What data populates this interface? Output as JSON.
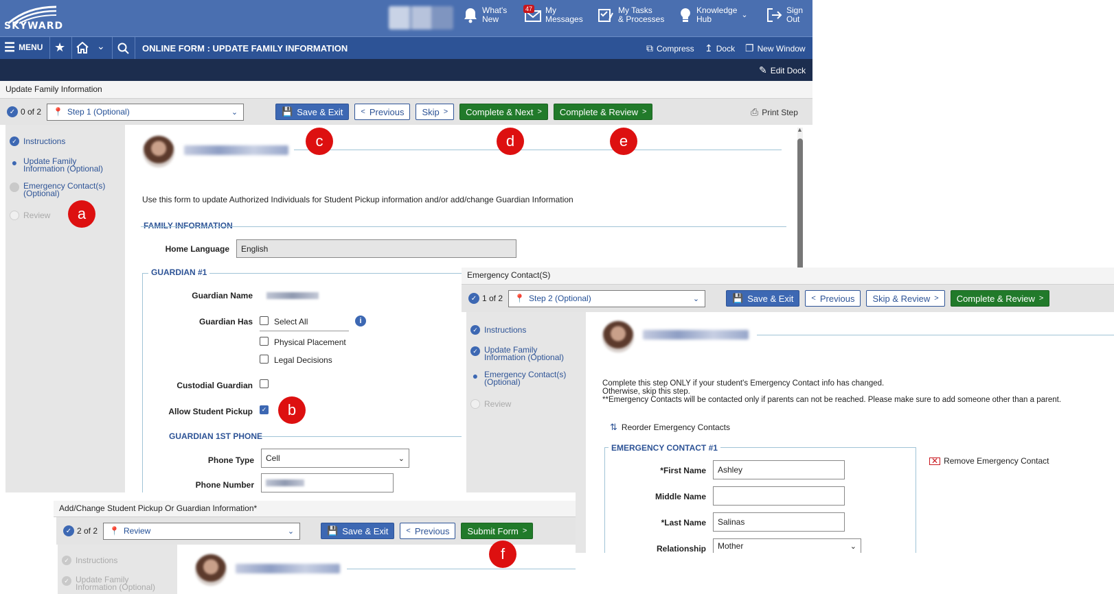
{
  "header": {
    "logo": "SKYWARD",
    "nav": [
      {
        "icon": "bell-icon",
        "label": "What's\nNew"
      },
      {
        "icon": "envelope-icon",
        "label": "My\nMessages",
        "badge": "47"
      },
      {
        "icon": "tasks-icon",
        "label": "My Tasks\n& Processes"
      },
      {
        "icon": "lightbulb-icon",
        "label": "Knowledge\nHub"
      },
      {
        "icon": "sign-out-icon",
        "label": "Sign\nOut"
      }
    ]
  },
  "navbar": {
    "menu": "MENU",
    "title": "ONLINE FORM : UPDATE FAMILY INFORMATION",
    "compress": "Compress",
    "dock": "Dock",
    "new_window": "New Window",
    "edit_dock": "Edit Dock"
  },
  "panel1": {
    "title": "Update Family Information",
    "progress": "0 of 2",
    "step": "Step 1 (Optional)",
    "buttons": {
      "save_exit": "Save & Exit",
      "previous": "Previous",
      "skip": "Skip",
      "complete_next": "Complete & Next",
      "complete_review": "Complete & Review",
      "print_step": "Print Step"
    },
    "sidebar": [
      "Instructions",
      "Update Family\nInformation (Optional)",
      "Emergency Contact(s)\n(Optional)",
      "Review"
    ],
    "intro": "Use this form to update Authorized Individuals for Student Pickup information and/or add/change Guardian Information",
    "family_heading": "FAMILY INFORMATION",
    "home_language_label": "Home Language",
    "home_language": "English",
    "guardian_heading": "GUARDIAN #1",
    "guardian_name_label": "Guardian Name",
    "guardian_has_label": "Guardian Has",
    "select_all": "Select All",
    "physical_placement": "Physical Placement",
    "legal_decisions": "Legal Decisions",
    "custodial_label": "Custodial Guardian",
    "pickup_label": "Allow Student Pickup",
    "phone_heading": "GUARDIAN 1ST PHONE",
    "phone_type_label": "Phone Type",
    "phone_type": "Cell",
    "phone_number_label": "Phone Number"
  },
  "panel2": {
    "title": "Emergency Contact(S)",
    "progress": "1 of 2",
    "step": "Step 2 (Optional)",
    "buttons": {
      "save_exit": "Save & Exit",
      "previous": "Previous",
      "skip_review": "Skip & Review",
      "complete_review": "Complete & Review"
    },
    "sidebar": [
      "Instructions",
      "Update Family\nInformation (Optional)",
      "Emergency Contact(s)\n(Optional)",
      "Review"
    ],
    "intro": "Complete this step ONLY if your student's Emergency Contact info has changed.\nOtherwise, skip this step.\n**Emergency Contacts will be contacted only if parents can not be reached. Please make sure to add someone other than a parent.",
    "reorder": "Reorder Emergency Contacts",
    "contact_heading": "EMERGENCY CONTACT #1",
    "remove": "Remove Emergency Contact",
    "first_name_label": "*First Name",
    "first_name": "Ashley",
    "middle_name_label": "Middle Name",
    "last_name_label": "*Last Name",
    "last_name": "Salinas",
    "relationship_label": "Relationship",
    "relationship": "Mother"
  },
  "panel3": {
    "title": "Add/Change Student Pickup Or Guardian Information*",
    "progress": "2 of 2",
    "step": "Review",
    "buttons": {
      "save_exit": "Save & Exit",
      "previous": "Previous",
      "submit": "Submit Form"
    },
    "sidebar": [
      "Instructions",
      "Update Family\nInformation (Optional)"
    ]
  },
  "markers": {
    "a": "a",
    "b": "b",
    "c": "c",
    "d": "d",
    "e": "e",
    "f": "f"
  },
  "colors": {
    "header": "#4a6fb0",
    "navbar": "#2d5396",
    "dockbar": "#1c2d4e",
    "primary": "#3d68b3",
    "success": "#217a2a",
    "marker": "#dd1010"
  }
}
